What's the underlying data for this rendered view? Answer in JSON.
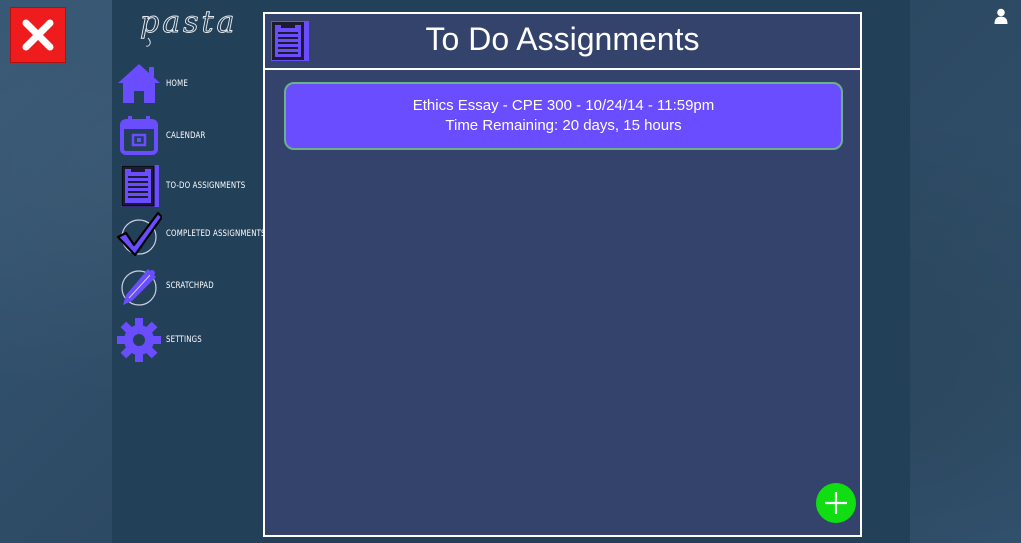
{
  "app": {
    "logo_text": "pasta",
    "accent_color": "#6a4dff",
    "close_icon": "close-icon",
    "user_icon": "user-icon"
  },
  "nav": {
    "items": [
      {
        "label": "HOME",
        "icon": "home-icon"
      },
      {
        "label": "CALENDAR",
        "icon": "calendar-icon"
      },
      {
        "label": "TO-DO ASSIGNMENTS",
        "icon": "clipboard-icon"
      },
      {
        "label": "COMPLETED ASSIGNMENTS",
        "icon": "checkmark-icon"
      },
      {
        "label": "SCRATCHPAD",
        "icon": "pen-icon"
      },
      {
        "label": "SETTINGS",
        "icon": "gear-icon"
      }
    ]
  },
  "main": {
    "title": "To Do Assignments",
    "header_icon": "clipboard-icon",
    "assignments": [
      {
        "line1": "Ethics Essay - CPE 300 - 10/24/14 - 11:59pm",
        "line2": "Time Remaining: 20 days, 15 hours"
      }
    ],
    "add_button_icon": "plus-icon",
    "add_button_color": "#11de12"
  }
}
